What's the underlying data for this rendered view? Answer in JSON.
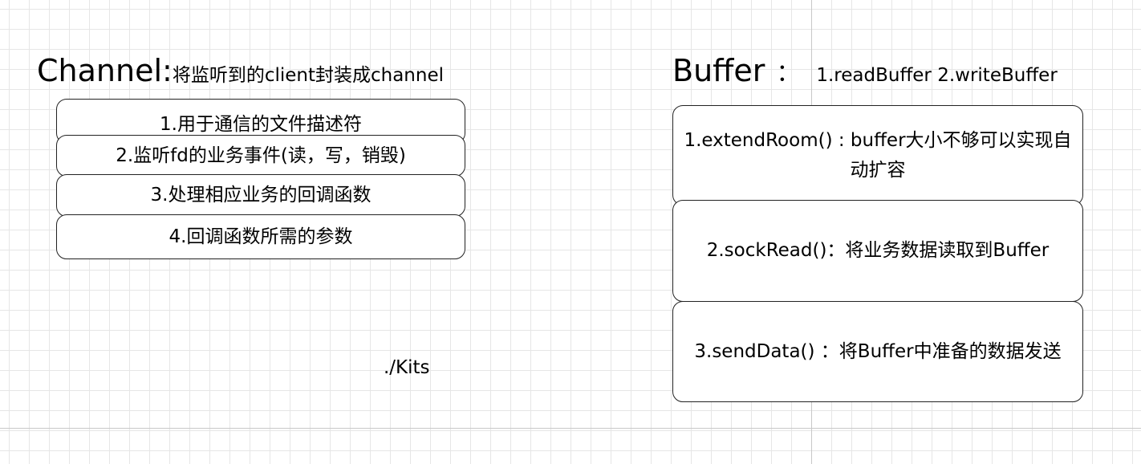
{
  "channel": {
    "title_main": "Channel:",
    "title_sub": "将监听到的client封装成channel",
    "items": [
      "1.用于通信的文件描述符",
      "2.监听fd的业务事件(读，写，销毁)",
      "3.处理相应业务的回调函数",
      "4.回调函数所需的参数"
    ]
  },
  "buffer": {
    "title_main": "Buffer",
    "title_sep": "：",
    "title_sub": "1.readBuffer 2.writeBuffer",
    "items": [
      "1.extendRoom() : buffer大小不够可以实现自动扩容",
      "2.sockRead()：将业务数据读取到Buffer",
      "3.sendData()  ：将Buffer中准备的数据发送"
    ]
  },
  "path_label": "./Kits"
}
